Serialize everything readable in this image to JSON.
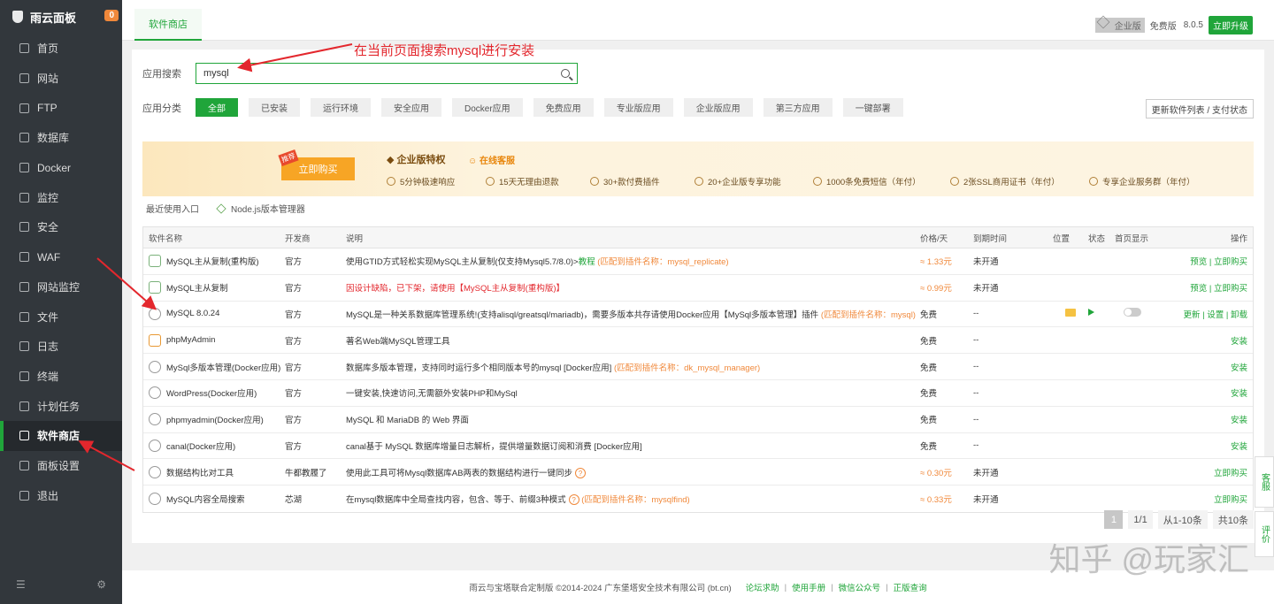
{
  "sidebar": {
    "brand": "雨云面板",
    "badge": "0",
    "items": [
      {
        "label": "首页",
        "icon": "home-icon"
      },
      {
        "label": "网站",
        "icon": "globe-icon"
      },
      {
        "label": "FTP",
        "icon": "ftp-icon"
      },
      {
        "label": "数据库",
        "icon": "database-icon"
      },
      {
        "label": "Docker",
        "icon": "docker-icon"
      },
      {
        "label": "监控",
        "icon": "monitor-icon"
      },
      {
        "label": "安全",
        "icon": "shield-icon"
      },
      {
        "label": "WAF",
        "icon": "waf-icon"
      },
      {
        "label": "网站监控",
        "icon": "site-monitor-icon"
      },
      {
        "label": "文件",
        "icon": "folder-icon"
      },
      {
        "label": "日志",
        "icon": "log-icon"
      },
      {
        "label": "终端",
        "icon": "terminal-icon"
      },
      {
        "label": "计划任务",
        "icon": "clock-icon"
      },
      {
        "label": "软件商店",
        "icon": "grid-icon",
        "active": true
      },
      {
        "label": "面板设置",
        "icon": "gear-icon"
      },
      {
        "label": "退出",
        "icon": "logout-icon"
      }
    ]
  },
  "topbar": {
    "tab": "软件商店",
    "edition": "企业版",
    "free": "免费版",
    "version": "8.0.5",
    "upgrade": "立即升级"
  },
  "annotation": "在当前页面搜索mysql进行安装",
  "search": {
    "label": "应用搜索",
    "value": "mysql"
  },
  "categories": {
    "label": "应用分类",
    "items": [
      "全部",
      "已安装",
      "运行环境",
      "安全应用",
      "Docker应用",
      "免费应用",
      "专业版应用",
      "企业版应用",
      "第三方应用",
      "一键部署"
    ],
    "refresh": "更新软件列表 / 支付状态"
  },
  "banner": {
    "tag": "推荐",
    "buy": "立即购买",
    "title": "企业版特权",
    "service": "在线客服",
    "features": [
      "5分钟极速响应",
      "15天无理由退款",
      "30+款付费插件",
      "20+企业版专享功能",
      "1000条免费短信（年付）",
      "2张SSL商用证书（年付）",
      "专享企业服务群（年付）"
    ]
  },
  "recent": {
    "label": "最近使用入口",
    "item": "Node.js版本管理器"
  },
  "table": {
    "headers": {
      "name": "软件名称",
      "dev": "开发商",
      "desc": "说明",
      "price": "价格/天",
      "expire": "到期时间",
      "location": "位置",
      "status": "状态",
      "home": "首页显示",
      "ops": "操作"
    },
    "rows": [
      {
        "name": "MySQL主从复制(重构版)",
        "dev": "官方",
        "desc": "使用GTID方式轻松实现MySQL主从复制(仅支持Mysql5.7/8.0)>",
        "desc_link": "教程",
        "match": "(匹配到插件名称：mysql_replicate)",
        "price": "≈ 1.33元",
        "expire": "未开通",
        "ops": "预览 | 立即购买"
      },
      {
        "name": "MySQL主从复制",
        "dev": "官方",
        "desc_red": "因设计缺陷，已下架，请使用【MySQL主从复制(重构版)】",
        "price": "≈ 0.99元",
        "expire": "未开通",
        "ops": "预览 | 立即购买"
      },
      {
        "name": "MySQL 8.0.24",
        "dev": "官方",
        "desc": "MySQL是一种关系数据库管理系统!(支持alisql/greatsql/mariadb)，需要多版本共存请使用Docker应用【MySql多版本管理】插件",
        "match": "(匹配到插件名称：mysql)",
        "price": "免费",
        "expire": "--",
        "ops": "更新 | 设置 | 卸载",
        "installed": true
      },
      {
        "name": "phpMyAdmin",
        "dev": "官方",
        "desc": "著名Web端MySQL管理工具",
        "price": "免费",
        "expire": "--",
        "ops": "安装"
      },
      {
        "name": "MySql多版本管理(Docker应用)",
        "dev": "官方",
        "desc": "数据库多版本管理，支持同时运行多个相同版本号的mysql [Docker应用]",
        "match": "(匹配到插件名称：dk_mysql_manager)",
        "price": "免费",
        "expire": "--",
        "ops": "安装"
      },
      {
        "name": "WordPress(Docker应用)",
        "dev": "官方",
        "desc": "一键安装,快速访问,无需额外安装PHP和MySql",
        "price": "免费",
        "expire": "--",
        "ops": "安装"
      },
      {
        "name": "phpmyadmin(Docker应用)",
        "dev": "官方",
        "desc": "MySQL 和 MariaDB 的 Web 界面",
        "price": "免费",
        "expire": "--",
        "ops": "安装"
      },
      {
        "name": "canal(Docker应用)",
        "dev": "官方",
        "desc": "canal基于 MySQL 数据库增量日志解析，提供增量数据订阅和消费 [Docker应用]",
        "price": "免费",
        "expire": "--",
        "ops": "安装"
      },
      {
        "name": "数据结构比对工具",
        "dev": "牛都教履了",
        "desc": "使用此工具可将Mysql数据库AB两表的数据结构进行一键同步",
        "help": "?",
        "price": "≈ 0.30元",
        "expire": "未开通",
        "ops": "立即购买"
      },
      {
        "name": "MySQL内容全局搜索",
        "dev": "芯湖",
        "desc": "在mysql数据库中全局查找内容，包含、等于、前缀3种模式",
        "help": "?",
        "match": "(匹配到插件名称：mysqlfind)",
        "price": "≈ 0.33元",
        "expire": "未开通",
        "ops": "立即购买"
      }
    ]
  },
  "pager": {
    "current": "1",
    "pages": "1/1",
    "range": "从1-10条",
    "total": "共10条"
  },
  "footer": {
    "copyright": "雨云与宝塔联合定制版 ©2014-2024 广东堡塔安全技术有限公司 (bt.cn)",
    "links": [
      "论坛求助",
      "使用手册",
      "微信公众号",
      "正版查询"
    ]
  },
  "float": {
    "service": "客服",
    "review": "评价"
  },
  "watermark": "知乎 @玩家汇"
}
